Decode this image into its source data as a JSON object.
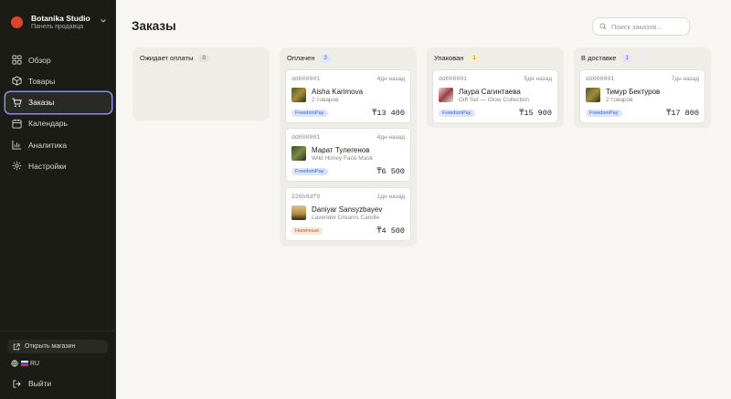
{
  "brand": {
    "name": "Botanika Studio",
    "subtitle": "Панель продавца"
  },
  "nav": [
    {
      "label": "Обзор",
      "icon": "grid-icon",
      "active": false
    },
    {
      "label": "Товары",
      "icon": "box-icon",
      "active": false
    },
    {
      "label": "Заказы",
      "icon": "cart-icon",
      "active": true
    },
    {
      "label": "Календарь",
      "icon": "calendar-icon",
      "active": false
    },
    {
      "label": "Аналитика",
      "icon": "chart-icon",
      "active": false
    },
    {
      "label": "Настройки",
      "icon": "gear-icon",
      "active": false
    }
  ],
  "sidebar_bottom": {
    "open_store": "Открыть магазин",
    "lang": "RU",
    "logout": "Выйти"
  },
  "page": {
    "title": "Заказы",
    "search_placeholder": "Поиск заказов..."
  },
  "columns": [
    {
      "title": "Ожидает оплаты",
      "count": "0",
      "cards": []
    },
    {
      "title": "Оплачен",
      "count": "3",
      "cards": [
        {
          "id": "dd000001",
          "time": "4дн назад",
          "name": "Aisha Karimova",
          "sub": "2 товаров",
          "payment": "FreedomPay",
          "amount": "₸13 400",
          "thumb": "t-green"
        },
        {
          "id": "dd000001",
          "time": "4дн назад",
          "name": "Марат Тулегенов",
          "sub": "Wild Honey Face Mask",
          "payment": "FreedomPay",
          "amount": "₸6 500",
          "thumb": "t-moss"
        },
        {
          "id": "226b8df9",
          "time": "1дн назад",
          "name": "Daniyar Sansyzbayev",
          "sub": "Lavender Dreams Candle",
          "payment": "Наличные",
          "amount": "₸4 500",
          "thumb": "t-sunset"
        }
      ]
    },
    {
      "title": "Упакован",
      "count": "1",
      "cards": [
        {
          "id": "dd000001",
          "time": "5дн назад",
          "name": "Лаура Сагинтаева",
          "sub": "Gift Set — Glow Collection",
          "payment": "FreedomPay",
          "amount": "₸15 900",
          "thumb": "t-pink"
        }
      ]
    },
    {
      "title": "В доставке",
      "count": "1",
      "cards": [
        {
          "id": "dd000001",
          "time": "7дн назад",
          "name": "Тимур Бектуров",
          "sub": "2 товаров",
          "payment": "FreedomPay",
          "amount": "₸17 800",
          "thumb": "t-green"
        }
      ]
    }
  ],
  "colors": {
    "sidebar_bg": "#1c1c17",
    "active_outline": "#8a8fe0",
    "brand_dot": "#d9452c",
    "page_bg": "#f7f6f2"
  }
}
